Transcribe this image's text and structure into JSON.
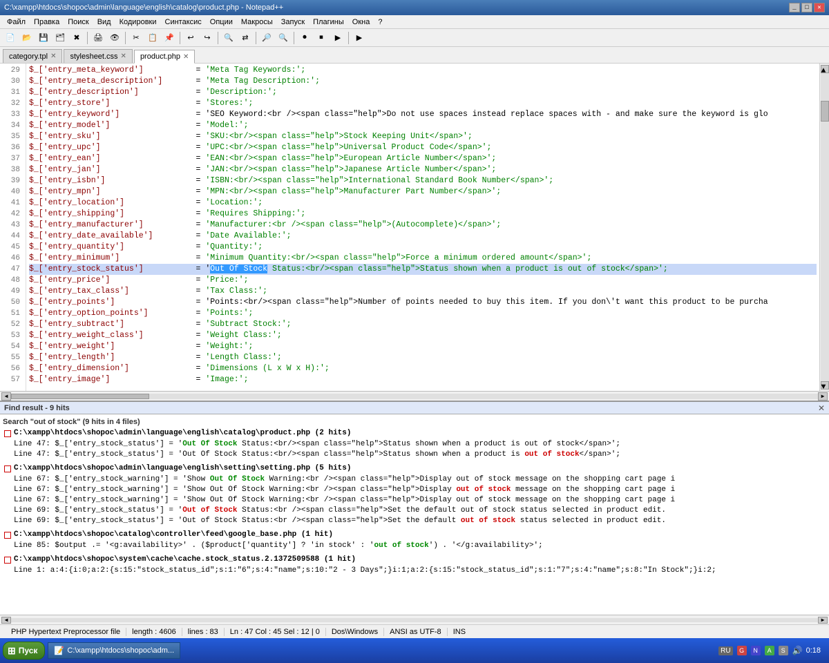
{
  "titleBar": {
    "title": "C:\\xampp\\htdocs\\shopoc\\admin\\language\\english\\catalog\\product.php - Notepad++",
    "minimizeLabel": "_",
    "maximizeLabel": "□",
    "closeLabel": "✕"
  },
  "menuBar": {
    "items": [
      "Файл",
      "Правка",
      "Поиск",
      "Вид",
      "Кодировки",
      "Синтаксис",
      "Опции",
      "Макросы",
      "Запуск",
      "Плагины",
      "Окна",
      "?"
    ]
  },
  "tabs": [
    {
      "label": "category.tpl",
      "active": false
    },
    {
      "label": "stylesheet.css",
      "active": false
    },
    {
      "label": "product.php",
      "active": true
    }
  ],
  "codeLines": [
    {
      "num": 29,
      "text": "$_['entry_meta_keyword']           = 'Meta Tag Keywords:';"
    },
    {
      "num": 30,
      "text": "$_['entry_meta_description']       = 'Meta Tag Description:';"
    },
    {
      "num": 31,
      "text": "$_['entry_description']            = 'Description:';"
    },
    {
      "num": 32,
      "text": "$_['entry_store']                  = 'Stores:';"
    },
    {
      "num": 33,
      "text": "$_['entry_keyword']                = 'SEO Keyword:<br /><span class=\"help\">Do not use spaces instead replace spaces with - and make sure the keyword is glo"
    },
    {
      "num": 34,
      "text": "$_['entry_model']                  = 'Model:';"
    },
    {
      "num": 35,
      "text": "$_['entry_sku']                    = 'SKU:<br/><span class=\"help\">Stock Keeping Unit</span>';"
    },
    {
      "num": 36,
      "text": "$_['entry_upc']                    = 'UPC:<br/><span class=\"help\">Universal Product Code</span>';"
    },
    {
      "num": 37,
      "text": "$_['entry_ean']                    = 'EAN:<br/><span class=\"help\">European Article Number</span>';"
    },
    {
      "num": 38,
      "text": "$_['entry_jan']                    = 'JAN:<br/><span class=\"help\">Japanese Article Number</span>';"
    },
    {
      "num": 39,
      "text": "$_['entry_isbn']                   = 'ISBN:<br/><span class=\"help\">International Standard Book Number</span>';"
    },
    {
      "num": 40,
      "text": "$_['entry_mpn']                    = 'MPN:<br/><span class=\"help\">Manufacturer Part Number</span>';"
    },
    {
      "num": 41,
      "text": "$_['entry_location']               = 'Location:';"
    },
    {
      "num": 42,
      "text": "$_['entry_shipping']               = 'Requires Shipping:';"
    },
    {
      "num": 43,
      "text": "$_['entry_manufacturer']           = 'Manufacturer:<br /><span class=\"help\">(Autocomplete)</span>';"
    },
    {
      "num": 44,
      "text": "$_['entry_date_available']         = 'Date Available:';"
    },
    {
      "num": 45,
      "text": "$_['entry_quantity']               = 'Quantity:';"
    },
    {
      "num": 46,
      "text": "$_['entry_minimum']                = 'Minimum Quantity:<br/><span class=\"help\">Force a minimum ordered amount</span>';"
    },
    {
      "num": 47,
      "text": "$_['entry_stock_status']           = 'Out Of Stock Status:<br/><span class=\"help\">Status shown when a product is out of stock</span>';",
      "highlight": true,
      "selectedStart": 43,
      "selectedEnd": 54
    },
    {
      "num": 48,
      "text": "$_['entry_price']                  = 'Price:';"
    },
    {
      "num": 49,
      "text": "$_['entry_tax_class']              = 'Tax Class:';"
    },
    {
      "num": 50,
      "text": "$_['entry_points']                 = 'Points:<br/><span class=\"help\">Number of points needed to buy this item. If you don\\'t want this product to be purcha"
    },
    {
      "num": 51,
      "text": "$_['entry_option_points']          = 'Points:';"
    },
    {
      "num": 52,
      "text": "$_['entry_subtract']               = 'Subtract Stock:';"
    },
    {
      "num": 53,
      "text": "$_['entry_weight_class']           = 'Weight Class:';"
    },
    {
      "num": 54,
      "text": "$_['entry_weight']                 = 'Weight:';"
    },
    {
      "num": 55,
      "text": "$_['entry_length']                 = 'Length Class:';"
    },
    {
      "num": 56,
      "text": "$_['entry_dimension']              = 'Dimensions (L x W x H):';"
    },
    {
      "num": 57,
      "text": "$_['entry_image']                  = 'Image:';"
    }
  ],
  "findPanel": {
    "title": "Find result - 9 hits",
    "searchQuery": "Search \"out of stock\" (9 hits in 4 files)",
    "closeLabel": "✕",
    "results": [
      {
        "file": "C:\\xampp\\htdocs\\shopoc\\admin\\language\\english\\catalog\\product.php (2 hits)",
        "lines": [
          "    Line 47: $_['entry_stock_status']    = 'Out Of Stock Status:<br/><span class=\"help\">Status shown when a product is out of stock</span>';",
          "    Line 47: $_['entry_stock_status']    = 'Out Of Stock Status:<br/><span class=\"help\">Status shown when a product is out of stock</span>';"
        ],
        "keywordPositions": [
          {
            "line": 0,
            "text1": "    Line 47: $_['entry_stock_status']    = '",
            "keyword": "Out Of Stock",
            "text2": " Status:<br/><span class=\"help\">Status shown when a product is out of stock</span>';"
          },
          {
            "line": 1,
            "text1": "    Line 47: $_['entry_stock_status']    = 'Out Of Stock Status:<br/><span class=\"help\">Status shown when a product is ",
            "keyword": "out of stock",
            "text2": "</span>';"
          }
        ]
      },
      {
        "file": "C:\\xampp\\htdocs\\shopoc\\admin\\language\\english\\setting\\setting.php (5 hits)",
        "lines": [
          "    Line 67: $_['entry_stock_warning']   = 'Show Out Of Stock Warning:<br /><span class=\"help\">Display out of stock message on the shopping cart page i",
          "    Line 67: $_['entry_stock_warning']   = 'Show Out Of Stock Warning:<br /><span class=\"help\">Display out of stock message on the shopping cart page i",
          "    Line 67: $_['entry_stock_warning']   = 'Show Out Of Stock Warning:<br /><span class=\"help\">Display out of stock message on the shopping cart page i",
          "    Line 69: $_['entry_stock_status']    = 'Out of Stock Status:<br /><span class=\"help\">Set the default out of stock status selected in product edit.",
          "    Line 69: $_['entry_stock_status']    = 'Out of Stock Status:<br /><span class=\"help\">Set the default out of stock status selected in product edit."
        ],
        "keywordPositions": [
          {
            "line": 0,
            "text1": "    Line 67: $_['entry_stock_warning']   = 'Show ",
            "keyword": "Out Of Stock",
            "text2": " Warning:<br /><span class=\"help\">Display out of stock message on the shopping cart page i"
          },
          {
            "line": 1,
            "text1": "    Line 67: $_['entry_stock_warning']   = 'Show Out Of Stock Warning:<br /><span class=\"help\">Display ",
            "keyword": "out of stock",
            "text2": " message on the shopping cart page i"
          },
          {
            "line": 2,
            "text1": "    Line 67: $_['entry_stock_warning']   = 'Show Out Of Stock Warning:<br /><span class=\"help\">Display out of stock message on the shopping cart page i",
            "keyword": "",
            "text2": ""
          },
          {
            "line": 3,
            "text1": "    Line 69: $_['entry_stock_status']    = '",
            "keyword": "Out of Stock",
            "text2": " Status:<br /><span class=\"help\">Set the default out of stock status selected in product edit."
          },
          {
            "line": 4,
            "text1": "    Line 69: $_['entry_stock_status']    = 'Out of Stock Status:<br /><span class=\"help\">Set the default ",
            "keyword": "out of stock",
            "text2": " status selected in product edit."
          }
        ]
      },
      {
        "file": "C:\\xampp\\htdocs\\shopoc\\catalog\\controller\\feed\\google_base.php (1 hit)",
        "lines": [
          "    Line 85:          $output .= '<g:availability>' . ($product['quantity'] ? 'in stock' : 'out of stock') . '</g:availability>';"
        ],
        "keywordPositions": [
          {
            "line": 0,
            "text1": "    Line 85:          $output .= '<g:availability>' . ($product['quantity'] ? 'in stock' : '",
            "keyword": "out of stock",
            "text2": "') . '</g:availability>';"
          }
        ]
      },
      {
        "file": "C:\\xampp\\htdocs\\shopoc\\system\\cache\\cache.stock_status.2.1372509588 (1 hit)",
        "lines": [
          "    Line 1: a:4:{i:0;a:2:{s:15:\"stock_status_id\";s:1:\"6\";s:4:\"name\";s:10:\"2 - 3 Days\";}i:1;a:2:{s:15:\"stock_status_id\";s:1:\"7\";s:4:\"name\";s:8:\"In Stock\";}i:2;"
        ],
        "keywordPositions": [
          {
            "line": 0,
            "text1": "    Line 1: a:4:{i:0;a:2:{s:15:\"stock_status_id\";s:1:\"6\";s:4:\"name\";s:10:\"2 - 3 Days\";}i:1;a:2:{s:15:\"stock_status_id\";s:1:\"7\";s:4:\"name\";s:8:\"In Stock\";}i:2;",
            "keyword": "",
            "text2": ""
          }
        ]
      }
    ]
  },
  "statusBar": {
    "fileType": "PHP Hypertext Preprocessor file",
    "length": "length : 4606",
    "lines": "lines : 83",
    "position": "Ln : 47  Col : 45  Sel : 12 | 0",
    "lineEnding": "Dos\\Windows",
    "encoding": "ANSI as UTF-8",
    "insertMode": "INS"
  },
  "taskbar": {
    "startLabel": "Пуск",
    "appLabel": "C:\\xampp\\htdocs\\shopoc\\adm...",
    "time": "0:18",
    "lang": "RU"
  }
}
